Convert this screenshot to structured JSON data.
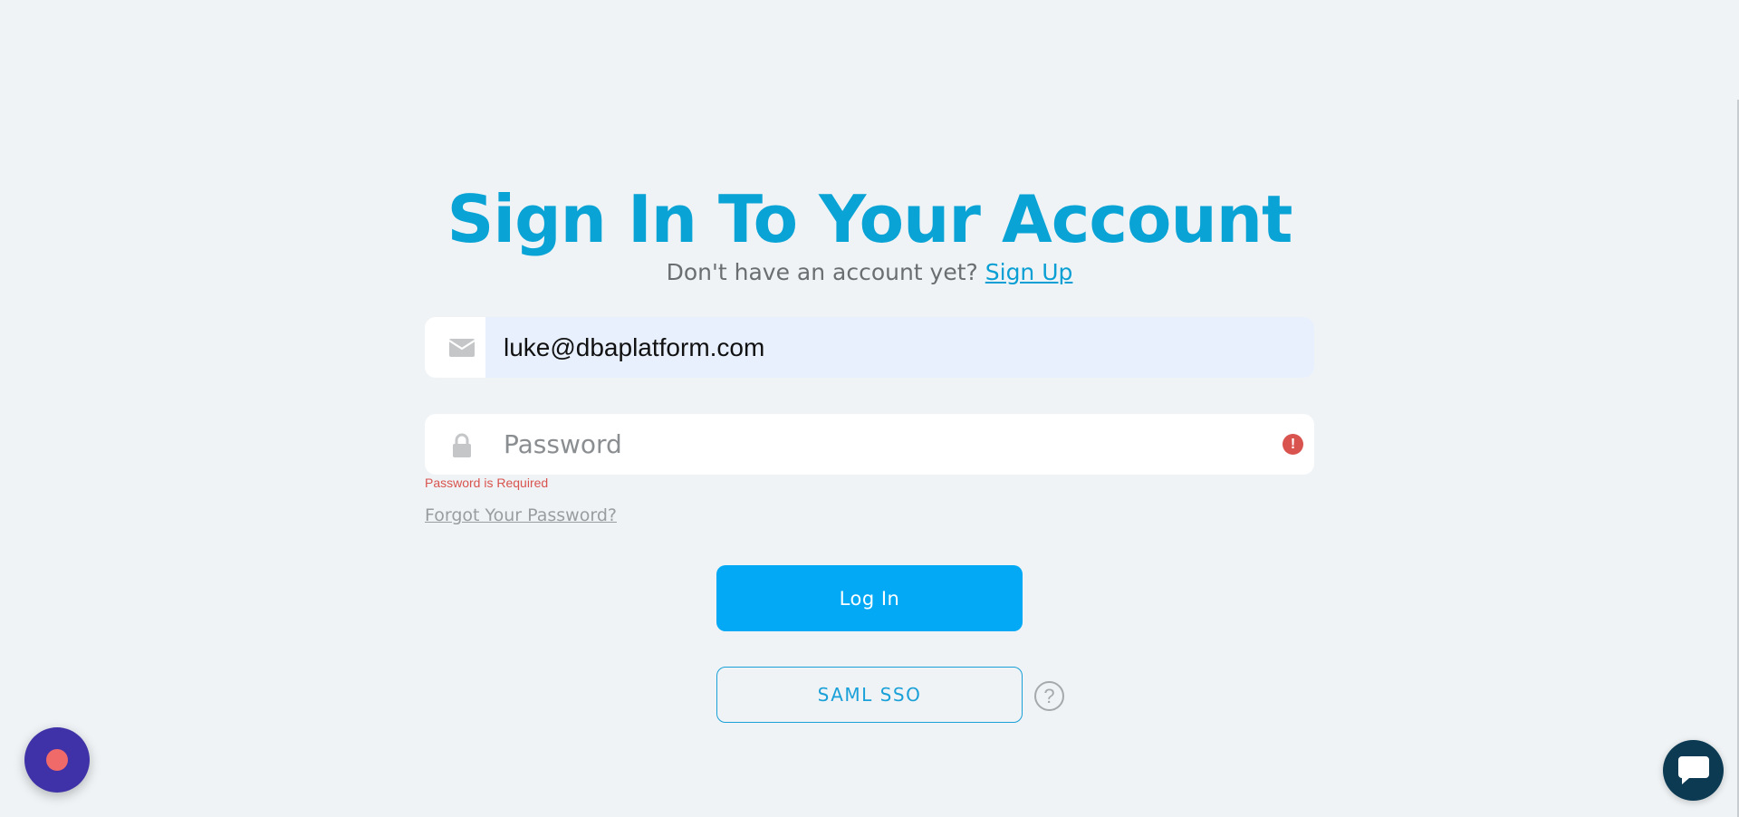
{
  "header": {
    "title": "Sign In To Your Account",
    "subtitle_prefix": "Don't have an account yet?",
    "signup_link": "Sign Up"
  },
  "form": {
    "email": {
      "value": "luke@dbaplatform.com",
      "icon": "envelope-icon"
    },
    "password": {
      "placeholder": "Password",
      "icon": "lock-icon",
      "error_icon": "alert-icon",
      "error_message": "Password is Required"
    },
    "forgot_link": "Forgot Your Password?",
    "login_label": "Log In",
    "saml_label": "SAML SSO",
    "help_icon": "question-icon"
  },
  "widgets": {
    "record": "record-icon",
    "chat": "chat-icon"
  },
  "colors": {
    "accent": "#0aa3d6",
    "button": "#03a9f4",
    "error": "#d9534f",
    "background": "#eff3f5"
  }
}
